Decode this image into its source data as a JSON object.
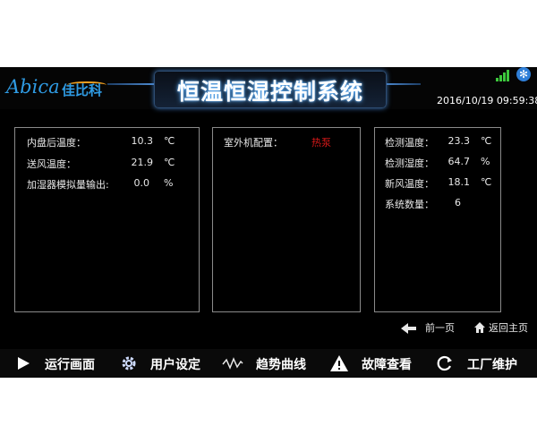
{
  "header": {
    "logo_text": "Abica",
    "logo_cn": "佳比科",
    "title": "恒温恒湿控制系统",
    "datetime": "2016/10/19 09:59:38",
    "status_icons": [
      "signal-icon",
      "fan-icon"
    ]
  },
  "panel_left": {
    "rows": [
      {
        "label": "内盘后温度：",
        "value": "10.3",
        "unit": "℃"
      },
      {
        "label": "送风温度：",
        "value": "21.9",
        "unit": "℃"
      },
      {
        "label": "加湿器模拟量输出:",
        "value": "0.0",
        "unit": "%"
      }
    ]
  },
  "panel_middle": {
    "label": "室外机配置：",
    "value": "热泵",
    "value_color": "#d81818"
  },
  "panel_right": {
    "rows": [
      {
        "label": "检测温度：",
        "value": "23.3",
        "unit": "℃"
      },
      {
        "label": "检测湿度：",
        "value": "64.7",
        "unit": "%"
      },
      {
        "label": "新风温度：",
        "value": "18.1",
        "unit": "℃"
      },
      {
        "label": "系统数量：",
        "value": "6",
        "unit": ""
      }
    ]
  },
  "nav": {
    "prev_label": "前一页",
    "home_label": "返回主页"
  },
  "bottom_menu": [
    {
      "label": "运行画面",
      "icon": "play-icon"
    },
    {
      "label": "用户设定",
      "icon": "gear-icon"
    },
    {
      "label": "趋势曲线",
      "icon": "trend-icon"
    },
    {
      "label": "故障查看",
      "icon": "warning-icon"
    },
    {
      "label": "工厂维护",
      "icon": "refresh-icon"
    }
  ]
}
